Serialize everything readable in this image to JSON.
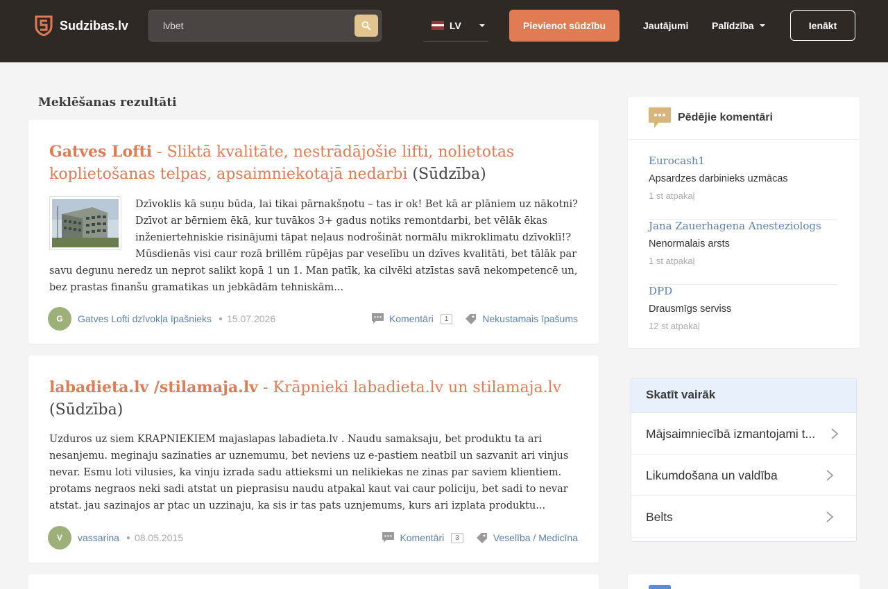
{
  "header": {
    "logo_text": "Sudzibas.lv",
    "search": {
      "value": "lvbet",
      "placeholder": ""
    },
    "language": "LV",
    "add_complaint_label": "Pievienot sūdzību",
    "nav": {
      "questions": "Jautājumi",
      "help": "Palīdzība"
    },
    "login_label": "Ienākt",
    "colors": {
      "bar": "#2f2926",
      "accent": "#e07b53",
      "search_button": "#e2c48d"
    }
  },
  "main": {
    "section_title": "Meklēšanas rezultāti",
    "results": [
      {
        "company": "Gatves Lofti",
        "title": " - Sliktā kvalitāte, nestrādājošie lifti, nolietotas koplietošanas telpas, apsaimniekotajā nedarbi",
        "type": " (Sūdzība)",
        "excerpt": "Dzīvoklis kā suņu būda, lai tikai pārnakšņotu – tas ir ok! Bet kā ar plāniem uz nākotni? Dzīvot ar bērniem ēkā, kur tuvākos 3+ gadus notiks remontdarbi, bet vēlāk ēkas inženiertehniskie risinājumi tāpat neļaus nodrošināt normālu mikroklimatu dzīvoklī!? Mūsdienās visi caur rozā brillēm rūpējas par veselību un dzīves kvalitāti, bet tālāk par savu degunu neredz un neprot salikt kopā 1 un 1. Man patīk, ka cilvēki atzīstas savā nekompetencē un, bez prastas finanšu gramatikas un jebkādām tehniskām...",
        "avatar_letter": "G",
        "author": "Gatves Lofti dzīvokļa īpašnieks",
        "date": "15.07.2026",
        "comments_label": "Komentāri",
        "comments_count": "1",
        "category": "Nekustamais īpašums"
      },
      {
        "company": "labadieta.lv /stilamaja.lv",
        "title": " - Krāpnieki labadieta.lv un stilamaja.lv",
        "type": " (Sūdzība)",
        "excerpt": "Uzduros uz siem KRAPNIEKIEM majaslapas labadieta.lv . Naudu samaksaju, bet produktu ta ari nesanjemu. meginaju sazinaties ar uznemumu, bet neviens uz e-pastiem neatbil un sazvanit ari vinjus nevar. Esmu loti vilusies, ka vinju izrada sadu attieksmi un nelikiekas ne zinas par saviem klientiem. protams negraos neki sadi atstat un pieprasisu naudu atpakal kaut vai caur policiju, bet sadi to nevar atstat. jau sazinajos ar ptac un uzzinaju, ka sis ir tas pats uznjemums, kurs ari izplata produktu...",
        "avatar_letter": "V",
        "author": "vassarina",
        "date": "08.05.2015",
        "comments_label": "Komentāri",
        "comments_count": "3",
        "category": "Veselība / Medicīna"
      }
    ]
  },
  "sidebar": {
    "recent_comments_title": "Pēdējie komentāri",
    "recent_comments": [
      {
        "author": "Eurocash1",
        "text": "Apsardzes darbinieks uzmācas",
        "time": "1 st atpakaļ"
      },
      {
        "author": "Jana Zauerhagena Anesteziologs",
        "text": "Nenormalais arsts",
        "time": "1 st atpakaļ"
      },
      {
        "author": "DPD",
        "text": "Drausmīgs serviss",
        "time": "12 st atpakaļ"
      }
    ],
    "see_more_title": "Skatīt vairāk",
    "see_more_items": [
      "Mājsaimniecībā izmantojami t...",
      "Likumdošana un valdība",
      "Belts"
    ]
  },
  "icons": {
    "logo": "shield-s-icon",
    "search": "magnifier-icon",
    "comments": "speech-bubble-icon",
    "tag": "tag-icon",
    "chevron": "chevron-right-icon"
  }
}
